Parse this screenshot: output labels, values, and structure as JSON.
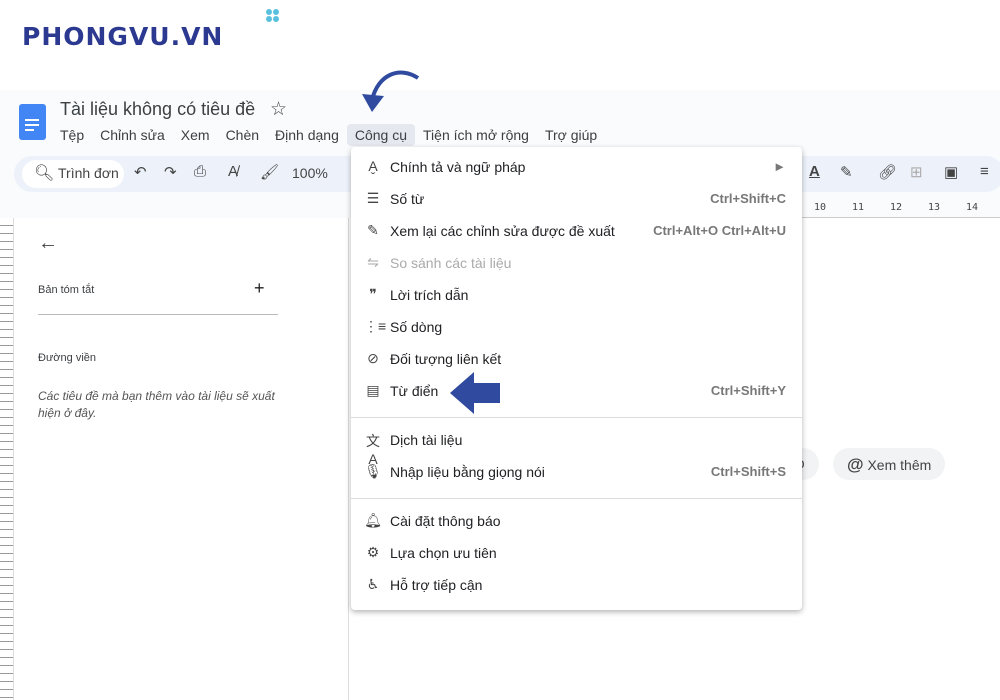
{
  "logo": "PHONGVU.VN",
  "doc": {
    "title": "Tài liệu không có tiêu đề"
  },
  "menubar": [
    "Tệp",
    "Chỉnh sửa",
    "Xem",
    "Chèn",
    "Định dạng",
    "Công cụ",
    "Tiện ích mở rộng",
    "Trợ giúp"
  ],
  "toolbar": {
    "search_placeholder": "Trình đơn",
    "zoom": "100%"
  },
  "ruler": [
    "10",
    "11",
    "12",
    "13",
    "14"
  ],
  "outline": {
    "summary": "Bản tóm tắt",
    "outline": "Đường viền",
    "hint": "Các tiêu đề mà bạn thêm vào tài liệu sẽ xuất hiện ở đây."
  },
  "chips": {
    "partial": "áp",
    "more": "Xem thêm"
  },
  "menu": [
    {
      "icon": "spellcheck-icon",
      "label": "Chính tả và ngữ pháp",
      "shortcut": "►"
    },
    {
      "icon": "word-count-icon",
      "label": "Số từ",
      "shortcut": "Ctrl+Shift+C"
    },
    {
      "icon": "review-edits-icon",
      "label": "Xem lại các chỉnh sửa được đề xuất",
      "shortcut": "Ctrl+Alt+O Ctrl+Alt+U"
    },
    {
      "icon": "compare-icon",
      "label": "So sánh các tài liệu",
      "shortcut": "",
      "disabled": true
    },
    {
      "icon": "quote-icon",
      "label": "Lời trích dẫn",
      "shortcut": ""
    },
    {
      "icon": "line-numbers-icon",
      "label": "Số dòng",
      "shortcut": ""
    },
    {
      "icon": "linked-objects-icon",
      "label": "Đối tượng liên kết",
      "shortcut": ""
    },
    {
      "icon": "dictionary-icon",
      "label": "Từ điển",
      "shortcut": "Ctrl+Shift+Y"
    },
    {
      "icon": "translate-icon",
      "label": "Dịch tài liệu",
      "shortcut": ""
    },
    {
      "icon": "microphone-icon",
      "label": "Nhập liệu bằng giọng nói",
      "shortcut": "Ctrl+Shift+S"
    },
    {
      "icon": "bell-icon",
      "label": "Cài đặt thông báo",
      "shortcut": ""
    },
    {
      "icon": "preferences-icon",
      "label": "Lựa chọn ưu tiên",
      "shortcut": ""
    },
    {
      "icon": "accessibility-icon",
      "label": "Hỗ trợ tiếp cận",
      "shortcut": ""
    }
  ],
  "colors": {
    "brand": "#2b3990",
    "arrow": "#2f4a9e",
    "doc_blue": "#4285f4"
  }
}
